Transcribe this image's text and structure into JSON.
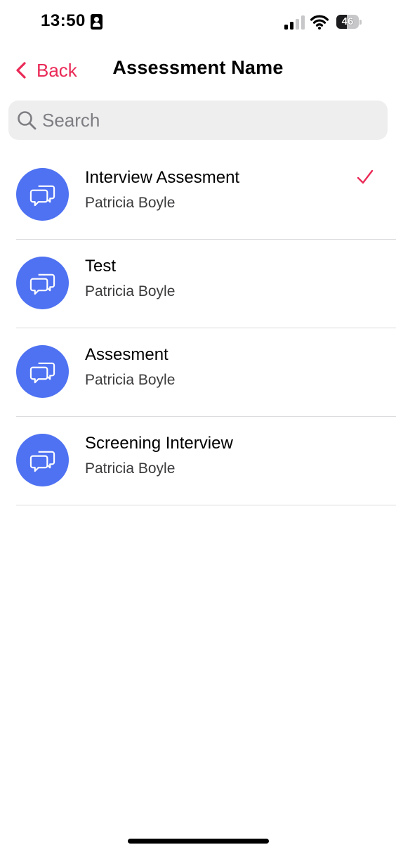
{
  "status_bar": {
    "time": "13:50",
    "battery_level": "46",
    "battery_fraction": 0.46,
    "icons": [
      "contact-card-icon",
      "cellular-signal-icon",
      "wifi-icon",
      "battery-icon"
    ]
  },
  "nav": {
    "back_label": "Back",
    "title": "Assessment Name",
    "accent_color": "#ea2a57"
  },
  "search": {
    "placeholder": "Search",
    "value": ""
  },
  "items": [
    {
      "title": "Interview Assesment",
      "subtitle": "Patricia Boyle",
      "icon": "chat-bubbles-icon",
      "selected": true
    },
    {
      "title": "Test",
      "subtitle": "Patricia Boyle",
      "icon": "chat-bubbles-icon",
      "selected": false
    },
    {
      "title": "Assesment",
      "subtitle": "Patricia Boyle",
      "icon": "chat-bubbles-icon",
      "selected": false
    },
    {
      "title": "Screening Interview",
      "subtitle": "Patricia Boyle",
      "icon": "chat-bubbles-icon",
      "selected": false
    }
  ],
  "colors": {
    "avatar": "#4f72f2",
    "checkmark": "#ea2a57",
    "search_background": "#eeeeef",
    "divider": "#dcdcdf"
  }
}
